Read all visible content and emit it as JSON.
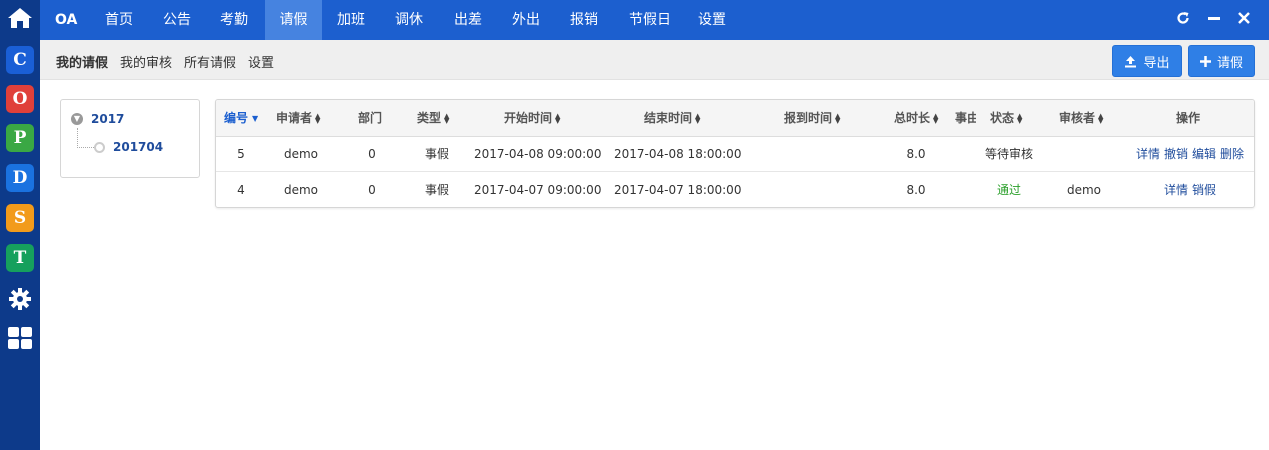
{
  "leftbar": {
    "items": [
      {
        "icon": "home-icon"
      },
      {
        "icon": "app-c-icon",
        "letter": "C",
        "color": "#1a5fd6"
      },
      {
        "icon": "app-o-icon",
        "letter": "O",
        "color": "#e0403a"
      },
      {
        "icon": "app-p-icon",
        "letter": "P",
        "color": "#3aa844"
      },
      {
        "icon": "app-d-icon",
        "letter": "D",
        "color": "#1a72e0"
      },
      {
        "icon": "app-s-icon",
        "letter": "S",
        "color": "#f29b1b"
      },
      {
        "icon": "app-t-icon",
        "letter": "T",
        "color": "#16a05d"
      },
      {
        "icon": "gear-icon"
      },
      {
        "icon": "grid-icon"
      }
    ]
  },
  "topnav": {
    "brand": "OA",
    "items": [
      "首页",
      "公告",
      "考勤",
      "请假",
      "加班",
      "调休",
      "出差",
      "外出",
      "报销",
      "节假日",
      "设置"
    ],
    "active": "请假"
  },
  "subnav": {
    "items": [
      "我的请假",
      "我的审核",
      "所有请假",
      "设置"
    ],
    "active": "我的请假",
    "export_label": "导出",
    "new_label": "请假"
  },
  "tree": {
    "year": "2017",
    "month": "201704"
  },
  "table": {
    "headers": [
      "编号",
      "申请者",
      "部门",
      "类型",
      "开始时间",
      "结束时间",
      "报到时间",
      "总时长",
      "事由",
      "状态",
      "审核者",
      "操作"
    ],
    "rows": [
      {
        "id": "5",
        "applicant": "demo",
        "dept": "0",
        "type": "事假",
        "start": "2017-04-08 09:00:00",
        "end": "2017-04-08 18:00:00",
        "report": "",
        "duration": "8.0",
        "reason": "",
        "status": "等待审核",
        "reviewer": "",
        "actions": [
          "详情",
          "撤销",
          "编辑",
          "删除"
        ]
      },
      {
        "id": "4",
        "applicant": "demo",
        "dept": "0",
        "type": "事假",
        "start": "2017-04-07 09:00:00",
        "end": "2017-04-07 18:00:00",
        "report": "",
        "duration": "8.0",
        "reason": "",
        "status": "通过",
        "reviewer": "demo",
        "actions": [
          "详情",
          "销假"
        ]
      }
    ]
  },
  "colors": {
    "topnav": "#1c5fcf",
    "leftbar": "#0d3a8a",
    "button": "#2f7fe6",
    "approved": "#2ca02c"
  }
}
